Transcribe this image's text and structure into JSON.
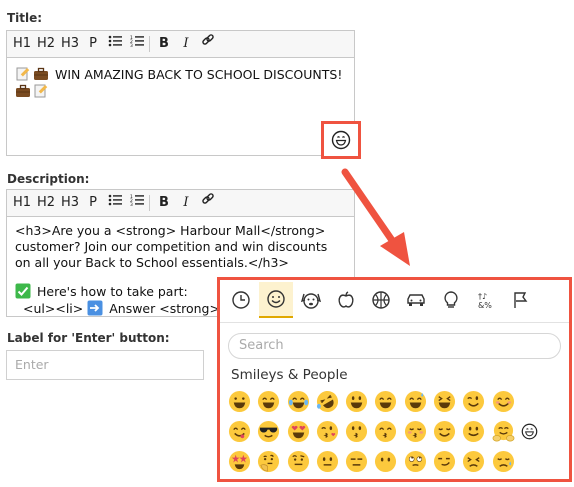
{
  "title_field": {
    "label": "Title:",
    "toolbar": [
      "H1",
      "H2",
      "H3",
      "P",
      "ul",
      "ol",
      "B",
      "I",
      "link"
    ],
    "text": "WIN AMAZING BACK TO SCHOOL DISCOUNTS!"
  },
  "description_field": {
    "label": "Description:",
    "line1": "<h3>Are you a <strong> Harbour Mall</strong>",
    "line2": "customer? Join our competition and win discounts",
    "line3": "on all your Back to School essentials.</h3>",
    "line4": "Here's how to take part:",
    "line5_partial": "<ul><li>",
    "line5_tail": "Answer <strong>all t"
  },
  "enter_button_field": {
    "label": "Label for 'Enter' button:",
    "placeholder": "Enter"
  },
  "emoji_picker": {
    "categories": [
      "recent",
      "smileys",
      "animals",
      "food",
      "activity",
      "travel",
      "objects",
      "symbols",
      "flags"
    ],
    "search_placeholder": "Search",
    "section_title": "Smileys & People"
  },
  "colors": {
    "highlight": "#ef5340",
    "emoji_yellow": "#fcc93d"
  }
}
